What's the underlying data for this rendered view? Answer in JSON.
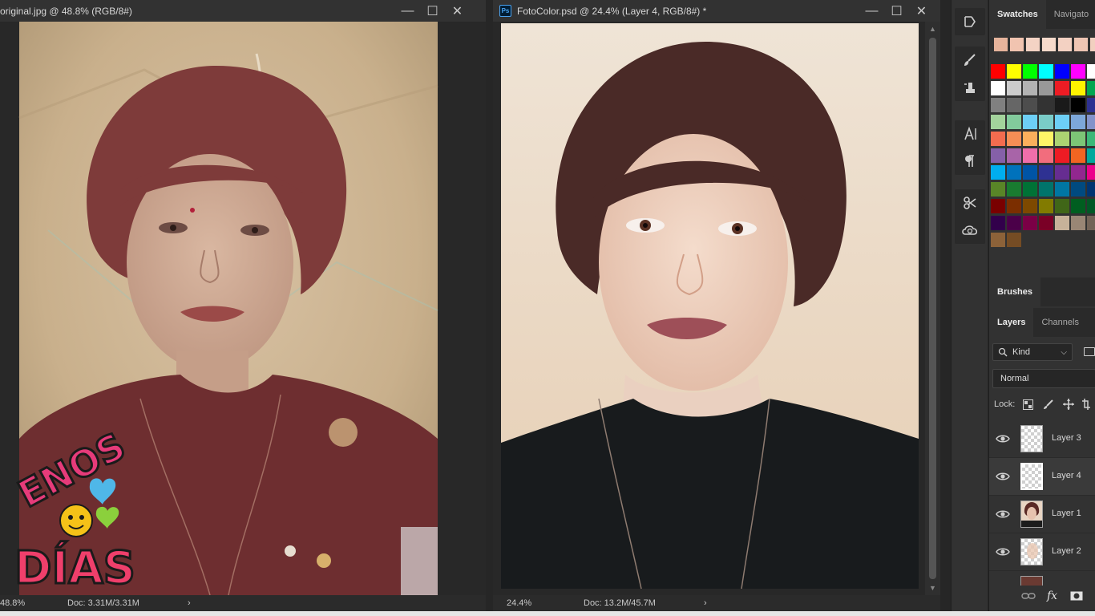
{
  "left_window": {
    "title": "original.jpg @ 48.8% (RGB/8#)",
    "zoom": "48.8%",
    "doc_size": "Doc: 3.31M/3.31M",
    "sticker_text": [
      "ENOS",
      "DÍAS"
    ]
  },
  "right_window": {
    "title": "FotoColor.psd @ 24.4% (Layer 4, RGB/8#) *",
    "zoom": "24.4%",
    "doc_size": "Doc: 13.2M/45.7M",
    "ps_badge": "Ps"
  },
  "window_buttons": {
    "minimize": "—",
    "maximize": "☐",
    "close": "✕"
  },
  "swatches_tabs": [
    {
      "label": "Swatches",
      "active": true
    },
    {
      "label": "Navigato",
      "active": false
    }
  ],
  "recent_swatches": [
    "#e6b49c",
    "#f1c4b0",
    "#f4d3c4",
    "#f6dacb",
    "#f3d1c2",
    "#eec5b3",
    "#f2d0c0"
  ],
  "swatch_rows": [
    [
      "#ff0000",
      "#ffff00",
      "#00ff00",
      "#00ffff",
      "#0000ff",
      "#ff00ff",
      "#ffffff"
    ],
    [
      "#ffffff",
      "#cccccc",
      "#b3b3b3",
      "#999999",
      "#ed1c24",
      "#fff200",
      "#00a651"
    ],
    [
      "#808080",
      "#666666",
      "#4d4d4d",
      "#333333",
      "#1a1a1a",
      "#000000",
      "#2e3192"
    ],
    [
      "#a3d39c",
      "#82ca9c",
      "#6dcff6",
      "#7accc8",
      "#6dcff6",
      "#7da7d9",
      "#8393ca"
    ],
    [
      "#f26c4f",
      "#f68e55",
      "#fbaf5c",
      "#fff467",
      "#acd372",
      "#7cc576",
      "#3bb878"
    ],
    [
      "#8560a8",
      "#a864a8",
      "#f06eaa",
      "#f26d7d",
      "#ed1c24",
      "#f26522",
      "#00a99d"
    ],
    [
      "#00aeef",
      "#0072bc",
      "#0054a6",
      "#2e3192",
      "#662d91",
      "#92278f",
      "#ec008c"
    ],
    [
      "#598527",
      "#197b30",
      "#007236",
      "#00746b",
      "#0076a3",
      "#004a80",
      "#003471"
    ],
    [
      "#790000",
      "#7b2e00",
      "#7d4900",
      "#827b00",
      "#406618",
      "#005e20",
      "#005826"
    ],
    [
      "#32004b",
      "#4b0049",
      "#7b0046",
      "#7a0026",
      "#c7b299",
      "#998675",
      "#736357"
    ],
    [
      "#8c6239",
      "#754c24",
      "",
      "",
      "",
      "",
      ""
    ]
  ],
  "brushes_tab": "Brushes",
  "layers_tabs": [
    {
      "label": "Layers",
      "active": true
    },
    {
      "label": "Channels",
      "active": false
    }
  ],
  "filter_kind": "Kind",
  "blend_mode": "Normal",
  "lock_label": "Lock:",
  "layers": [
    {
      "name": "Layer 3",
      "visible": true,
      "thumb": "transparent"
    },
    {
      "name": "Layer 4",
      "visible": true,
      "thumb": "transparent-selected"
    },
    {
      "name": "Layer 1",
      "visible": true,
      "thumb": "portrait"
    },
    {
      "name": "Layer 2",
      "visible": true,
      "thumb": "transparent-skin"
    }
  ],
  "bottom_icons": [
    "link-icon",
    "fx-icon",
    "mask-icon"
  ],
  "fx_label": "fx",
  "tool_icons": [
    "history-icon",
    "brush-settings-icon",
    "clone-source-icon",
    "character-icon",
    "paragraph-icon",
    "tool-presets-icon",
    "libraries-icon"
  ]
}
